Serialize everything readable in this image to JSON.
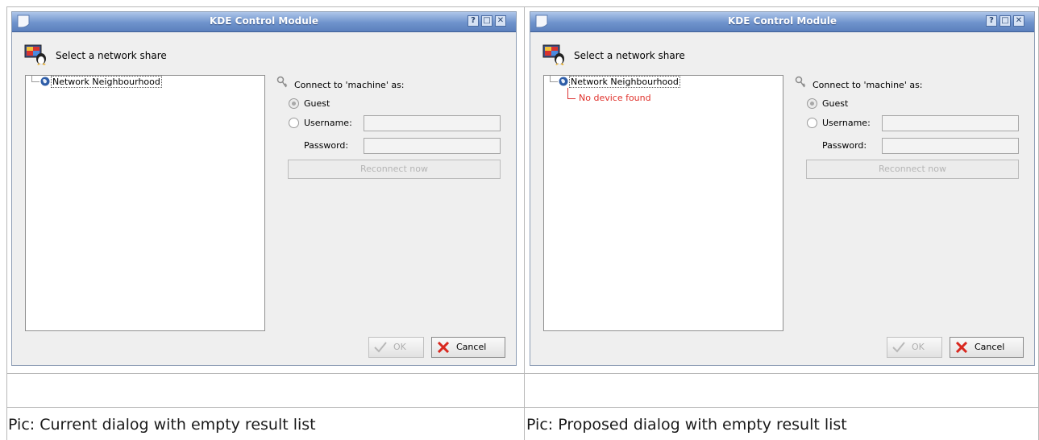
{
  "left_dialog": {
    "window_title": "KDE Control Module",
    "titlebar_buttons": {
      "help": "?",
      "maximize": "□",
      "close": "✕"
    },
    "header_text": "Select a network share",
    "tree_root": "Network Neighbourhood",
    "tree_child": "",
    "connect_label": "Connect to 'machine' as:",
    "guest_label": "Guest",
    "username_label": "Username:",
    "password_label": "Password:",
    "reconnect_label": "Reconnect now",
    "ok_label": "OK",
    "cancel_label": "Cancel",
    "guest_selected": true
  },
  "right_dialog": {
    "window_title": "KDE Control Module",
    "titlebar_buttons": {
      "help": "?",
      "maximize": "□",
      "close": "✕"
    },
    "header_text": "Select a network share",
    "tree_root": "Network Neighbourhood",
    "tree_child": "No device found",
    "connect_label": "Connect to 'machine' as:",
    "guest_label": "Guest",
    "username_label": "Username:",
    "password_label": "Password:",
    "reconnect_label": "Reconnect now",
    "ok_label": "OK",
    "cancel_label": "Cancel",
    "guest_selected": true
  },
  "captions": {
    "left": "Pic: Current dialog with empty result list",
    "right": "Pic: Proposed dialog with empty result list"
  },
  "colors": {
    "titlebar": "#6f93cc",
    "child_text": "#e0312b",
    "dialog_bg": "#efefef"
  },
  "icons": [
    "window-icon",
    "monitor-network-icon",
    "globe-icon",
    "key-icon",
    "checkmark-icon",
    "cancel-x-icon"
  ]
}
